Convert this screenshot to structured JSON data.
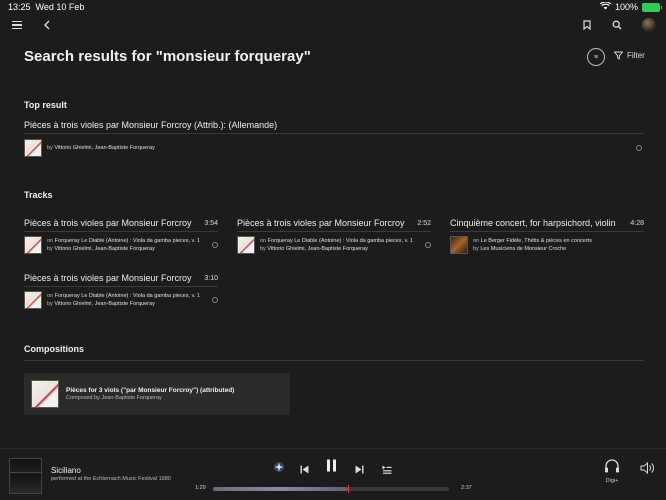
{
  "status": {
    "time": "13:25",
    "date": "Wed 10 Feb",
    "battery": "100%"
  },
  "header": {
    "title": "Search results for \"monsieur forqueray\"",
    "filter_label": "Filter",
    "view_toggle": "≡"
  },
  "top_result": {
    "section": "Top result",
    "title": "Pièces à trois violes par Monsieur Forcroy (Attrib.): (Allemande)",
    "by": "by",
    "artists": "Vittorio Ghielmi, Jean-Baptiste Forqueray"
  },
  "tracks": {
    "section": "Tracks",
    "items": [
      {
        "title": "Pièces à trois violes par Monsieur Forcroy",
        "duration": "3:54",
        "on": "on",
        "album": "Forqueray Le Diable (Antoine) : Viola da gamba pieces, v. 1",
        "by": "by",
        "artists": "Vittorio Ghielmi, Jean-Baptiste Forqueray"
      },
      {
        "title": "Pièces à trois violes par Monsieur Forcroy",
        "duration": "2:52",
        "on": "on",
        "album": "Forqueray Le Diable (Antoine) : Viola da gamba pieces, v. 1",
        "by": "by",
        "artists": "Vittorio Ghielmi, Jean-Baptiste Forqueray"
      },
      {
        "title": "Cinquième concert, for harpsichord, violin",
        "duration": "4:28",
        "on": "on",
        "album": "Le Berger Fidèle, Thétis & pièces en concerts",
        "by": "by",
        "artists": "Les Musiciens de Monsieur Croche"
      },
      {
        "title": "Pièces à trois violes par Monsieur Forcroy",
        "duration": "3:10",
        "on": "on",
        "album": "Forqueray Le Diable (Antoine) : Viola da gamba pieces, v. 1",
        "by": "by",
        "artists": "Vittorio Ghielmi, Jean-Baptiste Forqueray"
      }
    ]
  },
  "compositions": {
    "section": "Compositions",
    "items": [
      {
        "title": "Pièces for 3 viols (\"par Monsieur Forcroy\") (attributed)",
        "composer": "Composed by Jean-Baptiste Forqueray"
      }
    ]
  },
  "player": {
    "title": "Siciliano",
    "subtitle": "performed at the Echternach Music Festival 1980",
    "elapsed": "1:29",
    "total": "2:37",
    "progress": 0.57,
    "device_label": "Digi+"
  },
  "colors": {
    "background": "#1c1c1c",
    "card": "#2a2a2a",
    "progress_marker": "#e0303a",
    "battery": "#34c759",
    "accent_star": "#8fc3ff"
  }
}
